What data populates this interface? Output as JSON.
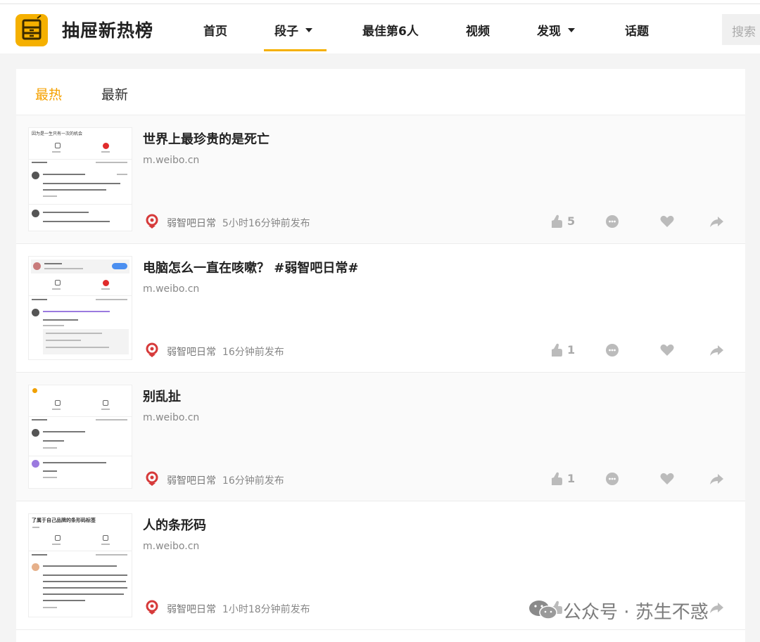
{
  "site": {
    "name": "抽屉新热榜",
    "logo_icon": "drawer-icon",
    "accent_color": "#f5b000"
  },
  "nav": {
    "items": [
      {
        "label": "首页",
        "dropdown": false
      },
      {
        "label": "段子",
        "dropdown": true,
        "active": true
      },
      {
        "label": "最佳第6人",
        "dropdown": false
      },
      {
        "label": "视频",
        "dropdown": false
      },
      {
        "label": "发现",
        "dropdown": true
      },
      {
        "label": "话题",
        "dropdown": false
      }
    ],
    "search_placeholder": "搜索"
  },
  "tabs": [
    {
      "label": "最热",
      "active": true
    },
    {
      "label": "最新",
      "active": false
    }
  ],
  "posts": [
    {
      "title": "世界上最珍贵的是死亡",
      "domain": "m.weibo.cn",
      "author": "弱智吧日常",
      "time": "5小时16分钟前发布",
      "likes": "5"
    },
    {
      "title": "电脑怎么一直在咳嗽？ #弱智吧日常#",
      "domain": "m.weibo.cn",
      "author": "弱智吧日常",
      "time": "16分钟前发布",
      "likes": "1"
    },
    {
      "title": "别乱扯",
      "domain": "m.weibo.cn",
      "author": "弱智吧日常",
      "time": "16分钟前发布",
      "likes": "1"
    },
    {
      "title": "人的条形码",
      "domain": "m.weibo.cn",
      "author": "弱智吧日常",
      "time": "1小时18分钟前发布",
      "likes": ""
    }
  ],
  "thumbnail_texts": {
    "post1_header": "因为是一生只有一次的机会",
    "post4_header": "了属于自己品牌的条形码标签"
  },
  "actions": {
    "like_icon": "thumbs-up-icon",
    "comment_icon": "comment-icon",
    "favorite_icon": "heart-icon",
    "share_icon": "share-icon"
  },
  "watermark": {
    "text": "公众号 · 苏生不惑",
    "icon": "wechat-icon"
  }
}
